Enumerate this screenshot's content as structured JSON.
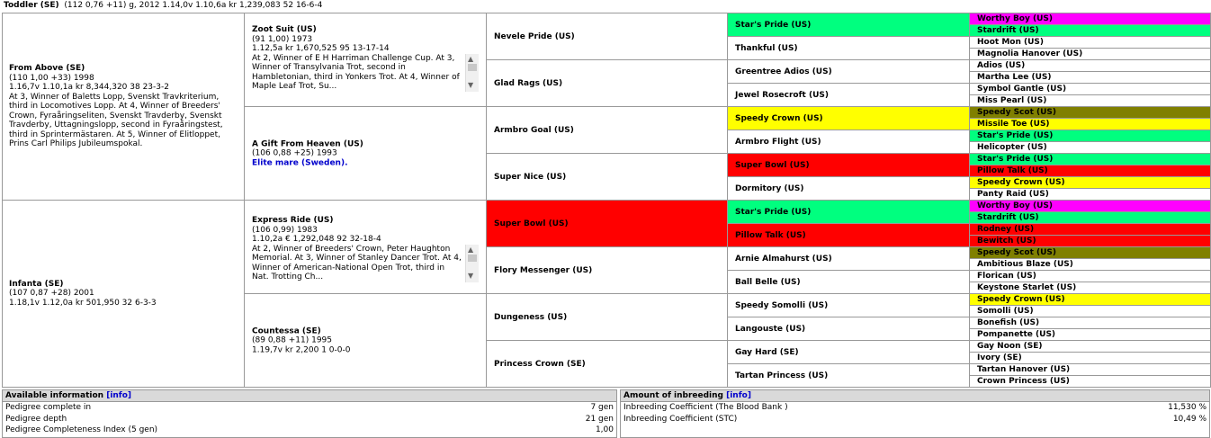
{
  "header": {
    "name": "Toddler (SE)",
    "details": "(112 0,76 +11) g, 2012  1.14,0v 1.10,6a kr 1,239,083 52 16-6-4"
  },
  "col1": [
    {
      "name": "From Above (SE)",
      "lines": [
        "(110 1,00 +33) 1998",
        "1.16,7v 1.10,1a kr 8,344,320 38 23-3-2",
        "At 3, Winner of Baletts Lopp, Svenskt Travkriterium, third in Locomotives Lopp. At 4, Winner of Breeders' Crown, Fyraåringseliten, Svenskt Travderby, Svenskt Travderby, Uttagningslopp, second in Fyraåringstest, third in Sprintermästaren. At 5, Winner of Elitloppet, Prins Carl Philips Jubileumspokal."
      ]
    },
    {
      "name": "Infanta (SE)",
      "lines": [
        "(107 0,87 +28) 2001",
        "1.18,1v 1.12,0a kr 501,950 32 6-3-3"
      ]
    }
  ],
  "col2": [
    {
      "name": "Zoot Suit (US)",
      "lines": [
        "(91 1,00) 1973",
        "1.12,5a kr 1,670,525 95 13-17-14",
        "At 2, Winner of E H Harriman Challenge Cup. At 3, Winner of Transylvania Trot, second in Hambletonian, third in Yonkers Trot. At 4, Winner of Maple Leaf Trot, Su..."
      ],
      "scroll": true
    },
    {
      "name": "A Gift From Heaven (US)",
      "lines": [
        "(106 0,88 +25) 1993"
      ],
      "link": "Elite mare (Sweden)."
    },
    {
      "name": "Express Ride (US)",
      "lines": [
        "(106 0,99) 1983",
        "1.10,2a € 1,292,048 92 32-18-4",
        "At 2, Winner of Breeders' Crown, Peter Haughton Memorial. At 3, Winner of Stanley Dancer Trot. At 4, Winner of American-National Open Trot, third in Nat. Trotting Ch..."
      ],
      "scroll": true
    },
    {
      "name": "Countessa (SE)",
      "lines": [
        "(89 0,88 +11) 1995",
        "1.19,7v  kr 2,200 1 0-0-0"
      ]
    }
  ],
  "col3": [
    "Nevele Pride (US)",
    "Glad Rags (US)",
    "Armbro Goal (US)",
    "Super Nice (US)",
    "Super Bowl (US)",
    "Flory Messenger (US)",
    "Dungeness (US)",
    "Princess Crown (SE)"
  ],
  "col4": [
    "Star's Pride (US)",
    "Thankful (US)",
    "Greentree Adios (US)",
    "Jewel Rosecroft (US)",
    "Speedy Crown (US)",
    "Armbro Flight (US)",
    "Super Bowl (US)",
    "Dormitory (US)",
    "Star's Pride (US)",
    "Pillow Talk (US)",
    "Arnie Almahurst (US)",
    "Ball Belle (US)",
    "Speedy Somolli (US)",
    "Langouste (US)",
    "Gay Hard (SE)",
    "Tartan Princess (US)"
  ],
  "col5": [
    "Worthy Boy (US)",
    "Stardrift (US)",
    "Hoot Mon (US)",
    "Magnolia Hanover (US)",
    "Adios (US)",
    "Martha Lee (US)",
    "Symbol Gantle (US)",
    "Miss Pearl (US)",
    "Speedy Scot (US)",
    "Missile Toe (US)",
    "Star's Pride (US)",
    "Helicopter (US)",
    "Star's Pride (US)",
    "Pillow Talk (US)",
    "Speedy Crown (US)",
    "Panty Raid (US)",
    "Worthy Boy (US)",
    "Stardrift (US)",
    "Rodney (US)",
    "Bewitch (US)",
    "Speedy Scot (US)",
    "Ambitious Blaze (US)",
    "Florican (US)",
    "Keystone Starlet (US)",
    "Speedy Crown (US)",
    "Somolli (US)",
    "Bonefish (US)",
    "Pompanette (US)",
    "Gay Noon (SE)",
    "Ivory (SE)",
    "Tartan Hanover (US)",
    "Crown Princess (US)"
  ],
  "colors": {
    "green": "#00ff7f",
    "magenta": "#ff00ff",
    "yellow": "#ffff00",
    "olive": "#808000",
    "red": "#ff0000",
    "white": "#ffffff"
  },
  "col3_colors": [
    "white",
    "white",
    "white",
    "white",
    "red",
    "white",
    "white",
    "white"
  ],
  "col4_colors": [
    "green",
    "white",
    "white",
    "white",
    "yellow",
    "white",
    "red",
    "white",
    "green",
    "red",
    "white",
    "white",
    "white",
    "white",
    "white",
    "white"
  ],
  "col5_colors": [
    "magenta",
    "green",
    "white",
    "white",
    "white",
    "white",
    "white",
    "white",
    "olive",
    "yellow",
    "green",
    "white",
    "green",
    "red",
    "yellow",
    "white",
    "magenta",
    "green",
    "red",
    "red",
    "olive",
    "white",
    "white",
    "white",
    "yellow",
    "white",
    "white",
    "white",
    "white",
    "white",
    "white",
    "white"
  ],
  "available": {
    "title": "Available information",
    "info": "[info]",
    "rows": [
      {
        "label": "Pedigree complete in",
        "value": "7 gen"
      },
      {
        "label": "Pedigree depth",
        "value": "21 gen"
      },
      {
        "label": "Pedigree Completeness Index (5 gen)",
        "value": "1,00"
      }
    ]
  },
  "inbreeding": {
    "title": "Amount of inbreeding",
    "info": "[info]",
    "rows": [
      {
        "label": "Inbreeding Coefficient (The Blood Bank )",
        "value": "11,530 %"
      },
      {
        "label": "Inbreeding Coefficient (STC)",
        "value": "10,49  %"
      }
    ]
  }
}
